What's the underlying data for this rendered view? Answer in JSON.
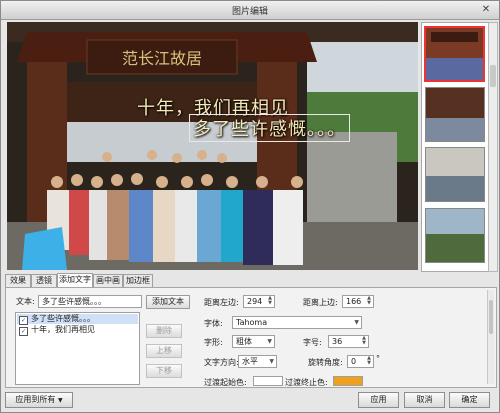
{
  "window": {
    "title": "图片编辑",
    "close_glyph": "✕"
  },
  "photo": {
    "gate_sign": "范长江故居",
    "overlay_lines": [
      "十年，我们再相见",
      "多了些许感慨。。。"
    ]
  },
  "tabs": [
    "效果",
    "透镜",
    "添加文字",
    "画中画",
    "加边框"
  ],
  "active_tab": "添加文字",
  "text_panel": {
    "text_label": "文本:",
    "text_value": "多了些许感慨。。。",
    "add_button": "添加文本",
    "items": [
      {
        "label": "多了些许感慨。。。",
        "checked": true
      },
      {
        "label": "十年，我们再相见",
        "checked": true
      }
    ],
    "delete_button": "删除",
    "up_button": "上移",
    "down_button": "下移"
  },
  "props": {
    "left_label": "距离左边:",
    "left_value": "294",
    "top_label": "距离上边:",
    "top_value": "166",
    "font_label": "字体:",
    "font_value": "Tahoma",
    "style_label": "字形:",
    "style_value": "粗体",
    "size_label": "字号:",
    "size_value": "36",
    "direction_label": "文字方向:",
    "direction_value": "水平",
    "rotate_label": "旋转角度:",
    "rotate_value": "0",
    "rotate_unit": "°",
    "grad_start_label": "过渡起始色:",
    "grad_end_label": "过渡终止色:",
    "grad_start_color": "#ffffff",
    "grad_end_color": "#f0a020"
  },
  "buttons": {
    "apply_all": "应用到所有",
    "apply": "应用",
    "cancel": "取消",
    "ok": "确定"
  }
}
